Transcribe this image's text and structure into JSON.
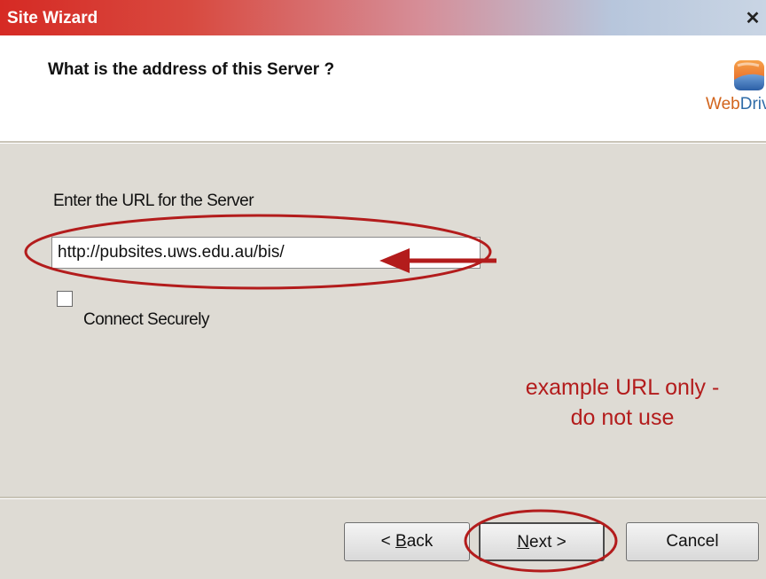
{
  "window": {
    "title": "Site Wizard",
    "close_symbol": "✕",
    "header_title": "What is the address of this Server ?",
    "logo_icon": "webdrive-logo-icon",
    "logo_text_part1": "Web",
    "logo_text_part2": "Drive"
  },
  "form": {
    "url_label": "Enter the URL for the Server",
    "url_value": "http://pubsites.uws.edu.au/bis/",
    "connect_securely_label": "Connect Securely",
    "connect_securely_checked": false
  },
  "annotation": {
    "line1": "example URL only -",
    "line2": "do not use",
    "color": "#b31c1c"
  },
  "buttons": {
    "back_label_mnemonic": "B",
    "back_label_rest": "ack",
    "back_prefix": "< ",
    "next_label_mnemonic": "N",
    "next_label_rest": "ext",
    "next_suffix": " >",
    "cancel_label": "Cancel"
  }
}
